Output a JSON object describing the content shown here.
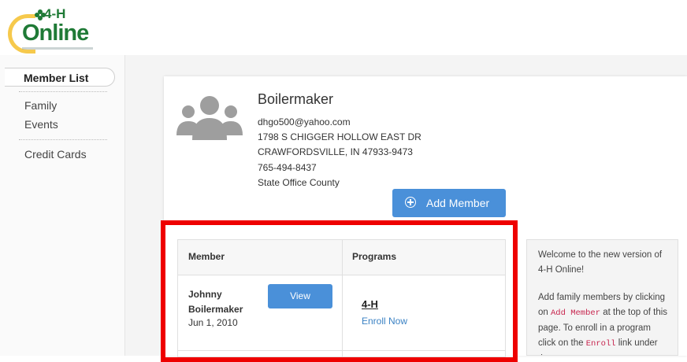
{
  "logo": {
    "top_text": "4-H",
    "main_text": "Online"
  },
  "sidebar": {
    "items": [
      {
        "label": "Member List",
        "active": true
      },
      {
        "label": "Family"
      },
      {
        "label": "Events"
      },
      {
        "label": "Credit Cards"
      }
    ]
  },
  "family": {
    "name": "Boilermaker",
    "email": "dhgo500@yahoo.com",
    "address1": "1798 S CHIGGER HOLLOW EAST DR",
    "address2": "CRAWFORDSVILLE, IN 47933-9473",
    "phone": "765-494-8437",
    "county": "State Office County",
    "add_member_label": "Add Member"
  },
  "table": {
    "headers": {
      "member": "Member",
      "programs": "Programs"
    },
    "rows": [
      {
        "name": "Johnny Boilermaker",
        "dob": "Jun 1, 2010",
        "view_label": "View",
        "program": "4-H",
        "enroll_label": "Enroll Now"
      }
    ]
  },
  "info": {
    "welcome": "Welcome to the new version of 4-H Online!",
    "p2_part1": "Add family members by clicking on ",
    "p2_code1": "Add Member",
    "p2_part2": " at the top of this page. To enroll in a program click on the ",
    "p2_code2": "Enroll",
    "p2_part3": " link under the program"
  },
  "colors": {
    "accent": "#4a90d9",
    "highlight": "#ee0000",
    "brand_green": "#1f7a36",
    "logo_yellow": "#f6c94c"
  }
}
